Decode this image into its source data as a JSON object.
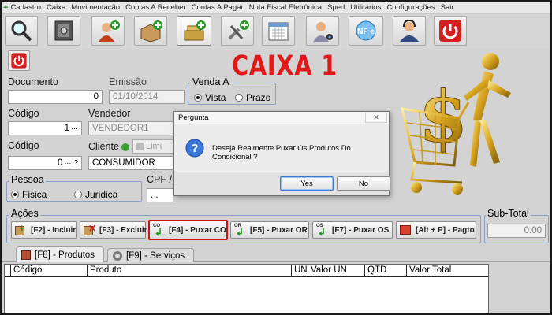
{
  "menu": [
    "Cadastro",
    "Caixa",
    "Movimentação",
    "Contas A Receber",
    "Contas A Pagar",
    "Nota Fiscal Eletrônica",
    "Sped",
    "Utilitários",
    "Configurações",
    "Sair"
  ],
  "toolbar_icons": [
    "search-icon",
    "safe-icon",
    "add-user-icon",
    "add-box-icon",
    "add-register-icon",
    "add-tools-icon",
    "calendar-icon",
    "user-webcam-icon",
    "nfe-icon",
    "support-agent-icon",
    "power-icon"
  ],
  "header": {
    "title": "CAIXA 1"
  },
  "form": {
    "documento_label": "Documento",
    "documento_value": "0",
    "emissao_label": "Emissão",
    "emissao_value": "01/10/2014",
    "venda_label": "Venda A",
    "vista_label": "Vista",
    "prazo_label": "Prazo",
    "codigo1_label": "Código",
    "codigo1_value": "1",
    "vendedor_label": "Vendedor",
    "vendedor_value": "VENDEDOR1",
    "codigo2_label": "Código",
    "codigo2_value": "0",
    "cliente_label": "Cliente",
    "limite_label": "Limi",
    "cliente_value": "CONSUMIDOR",
    "pessoa_label": "Pessoa",
    "fisica_label": "Fisica",
    "juridica_label": "Juridica",
    "cpf_label": "CPF /",
    "cpf_value": ". ."
  },
  "dialog": {
    "title": "Pergunta",
    "message": "Deseja Realmente Puxar Os Produtos Do Condicional ?",
    "yes": "Yes",
    "no": "No"
  },
  "acoes": {
    "label": "Ações",
    "buttons": [
      "[F2] - Incluir",
      "[F3] - Excluir",
      "[F4] - Puxar CO",
      "[F5] - Puxar OR",
      "[F7] - Puxar OS",
      "[Alt + P] - Pagto"
    ]
  },
  "subtotal": {
    "label": "Sub-Total",
    "value": "0.00"
  },
  "tabs": [
    "[F8] - Produtos",
    "[F9] - Serviços"
  ],
  "grid": {
    "columns": [
      "Código",
      "Produto",
      "UN",
      "Valor UN",
      "QTD",
      "Valor Total"
    ]
  },
  "colors": {
    "title_red": "#e01818",
    "highlight_border": "#d01010",
    "power_red": "#d42020"
  }
}
